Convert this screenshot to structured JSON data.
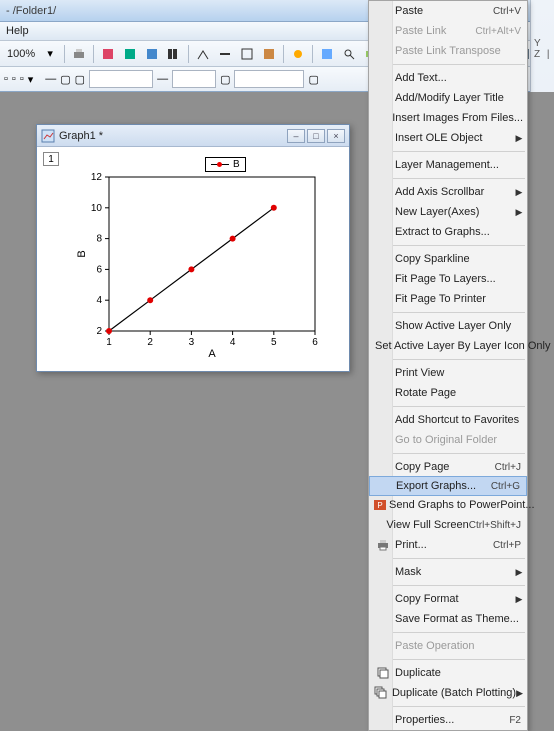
{
  "titlebar": {
    "path": "- /Folder1/"
  },
  "menubar": {
    "help": "Help"
  },
  "toolbar": {
    "zoom": "100%"
  },
  "right_strip": {
    "letters": "Y Z |"
  },
  "graph_window": {
    "title": "Graph1 *",
    "layer_badge": "1",
    "legend_label": "B",
    "xlabel": "A",
    "ylabel": "B"
  },
  "chart_data": {
    "type": "line",
    "title": "",
    "xlabel": "A",
    "ylabel": "B",
    "xlim": [
      1,
      6
    ],
    "ylim": [
      2,
      12
    ],
    "xticks": [
      1,
      2,
      3,
      4,
      5,
      6
    ],
    "yticks": [
      2,
      4,
      6,
      8,
      10,
      12
    ],
    "series": [
      {
        "name": "B",
        "x": [
          1,
          2,
          3,
          4,
          5
        ],
        "y": [
          2,
          4,
          6,
          8,
          10
        ],
        "color": "#e00000",
        "marker": "circle",
        "line_color": "#000000"
      }
    ]
  },
  "ctx": {
    "paste": "Paste",
    "paste_sc": "Ctrl+V",
    "paste_link": "Paste Link",
    "paste_link_sc": "Ctrl+Alt+V",
    "paste_link_transpose": "Paste Link Transpose",
    "add_text": "Add Text...",
    "layer_title": "Add/Modify Layer Title",
    "insert_images": "Insert Images From Files...",
    "insert_ole": "Insert OLE Object",
    "layer_mgmt": "Layer Management...",
    "add_axis_scrollbar": "Add Axis Scrollbar",
    "new_layer": "New Layer(Axes)",
    "extract": "Extract to Graphs...",
    "copy_sparkline": "Copy Sparkline",
    "fit_layers": "Fit Page To Layers...",
    "fit_printer": "Fit Page To Printer",
    "show_active": "Show Active Layer Only",
    "set_active": "Set Active Layer By Layer Icon Only",
    "print_view": "Print View",
    "rotate": "Rotate Page",
    "add_shortcut": "Add Shortcut to Favorites",
    "go_original": "Go to Original Folder",
    "copy_page": "Copy Page",
    "copy_page_sc": "Ctrl+J",
    "export_graphs": "Export Graphs...",
    "export_graphs_sc": "Ctrl+G",
    "send_ppt": "Send Graphs to PowerPoint...",
    "view_full": "View Full Screen",
    "view_full_sc": "Ctrl+Shift+J",
    "print": "Print...",
    "print_sc": "Ctrl+P",
    "mask": "Mask",
    "copy_format": "Copy Format",
    "save_theme": "Save Format as Theme...",
    "paste_op": "Paste Operation",
    "duplicate": "Duplicate",
    "duplicate_batch": "Duplicate (Batch Plotting)",
    "properties": "Properties...",
    "properties_sc": "F2"
  }
}
